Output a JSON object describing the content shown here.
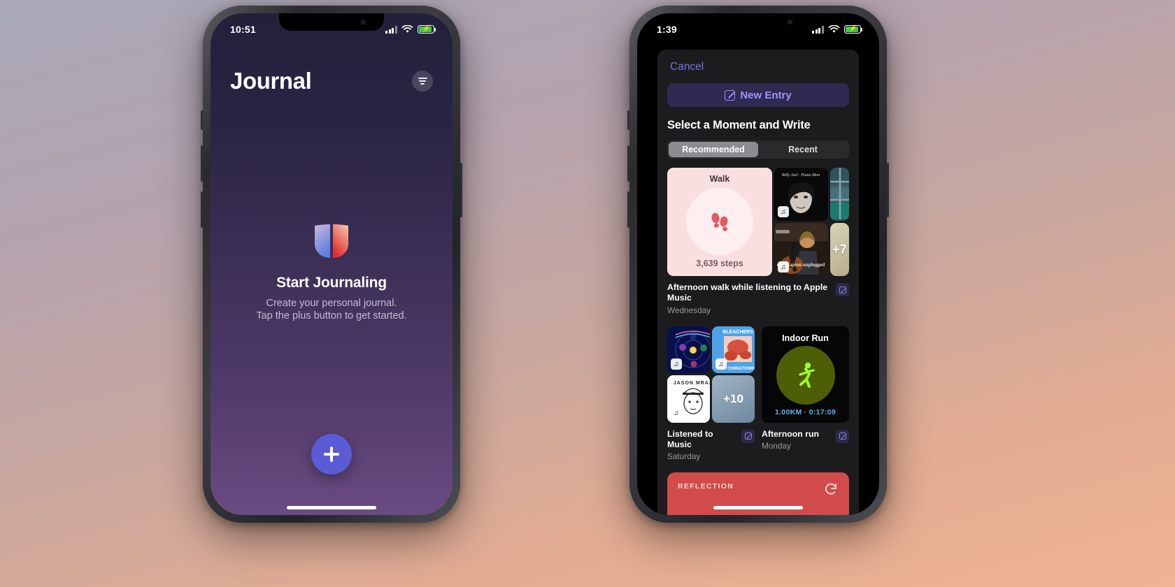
{
  "scene": {
    "background_gradient": [
      "#a8a8b8",
      "#b5a3ae",
      "#c9a79e",
      "#e3ac92",
      "#f0b394"
    ]
  },
  "left_phone": {
    "status_bar": {
      "time": "10:51",
      "signal_icon": "cellular-bars-icon",
      "wifi_icon": "wifi-icon",
      "battery_icon": "battery-charging-icon"
    },
    "nav": {
      "title": "Journal",
      "filter_icon": "filter-lines-icon"
    },
    "empty_state": {
      "app_icon": "journal-butterfly-icon",
      "title": "Start Journaling",
      "line1": "Create your personal journal.",
      "line2": "Tap the plus button to get started."
    },
    "fab": {
      "icon": "plus-icon",
      "color": "#5b5bd6"
    }
  },
  "right_phone": {
    "status_bar": {
      "time": "1:39",
      "signal_icon": "cellular-bars-icon",
      "wifi_icon": "wifi-icon",
      "battery_icon": "battery-charging-icon"
    },
    "sheet": {
      "cancel_label": "Cancel",
      "new_entry": {
        "label": "New Entry",
        "icon": "compose-square-icon"
      },
      "heading": "Select a Moment and Write",
      "segments": [
        {
          "label": "Recommended",
          "selected": true
        },
        {
          "label": "Recent",
          "selected": false
        }
      ],
      "suggestions": [
        {
          "title": "Afternoon walk while listening to Apple Music",
          "subtitle": "Wednesday",
          "edit_icon": "compose-square-icon",
          "walk_tile": {
            "label": "Walk",
            "steps": "3,639 steps",
            "icon": "footprints-icon",
            "bg": "#fadfe0",
            "accent": "#e05b63"
          },
          "tiles": [
            {
              "name": "album-art-billy-joel",
              "badge": "music-note-icon"
            },
            {
              "name": "album-art-eric-clapton-unplugged",
              "caption": "eric clapton unplugged",
              "badge": "music-note-icon"
            },
            {
              "name": "map-thumbnail"
            },
            {
              "name": "more-photos-tile",
              "label": "+7"
            }
          ]
        },
        {
          "title": "Listened to Music",
          "subtitle": "Saturday",
          "edit_icon": "compose-square-icon",
          "tiles": [
            {
              "name": "album-art-coldplay-music-of-the-spheres",
              "badge": "music-note-icon"
            },
            {
              "name": "album-art-bleachers-chinatown",
              "artist": "BLEACHERS",
              "track": "CHINATOWN",
              "badge": "music-note-icon"
            },
            {
              "name": "album-art-jason-mraz",
              "artist": "JASON MRAZ",
              "badge": "music-note-icon"
            },
            {
              "name": "more-music-tile",
              "label": "+10"
            }
          ]
        },
        {
          "title": "Afternoon run",
          "subtitle": "Monday",
          "edit_icon": "compose-square-icon",
          "run_card": {
            "label": "Indoor Run",
            "icon": "running-person-icon",
            "stats": "1.00KM · 0:17:09",
            "disc_color": "#4c5f05",
            "stat_color": "#5ab4ef"
          }
        }
      ],
      "reflection": {
        "label": "REFLECTION",
        "refresh_icon": "refresh-circular-icon",
        "bg": "#d14b4b"
      }
    }
  }
}
